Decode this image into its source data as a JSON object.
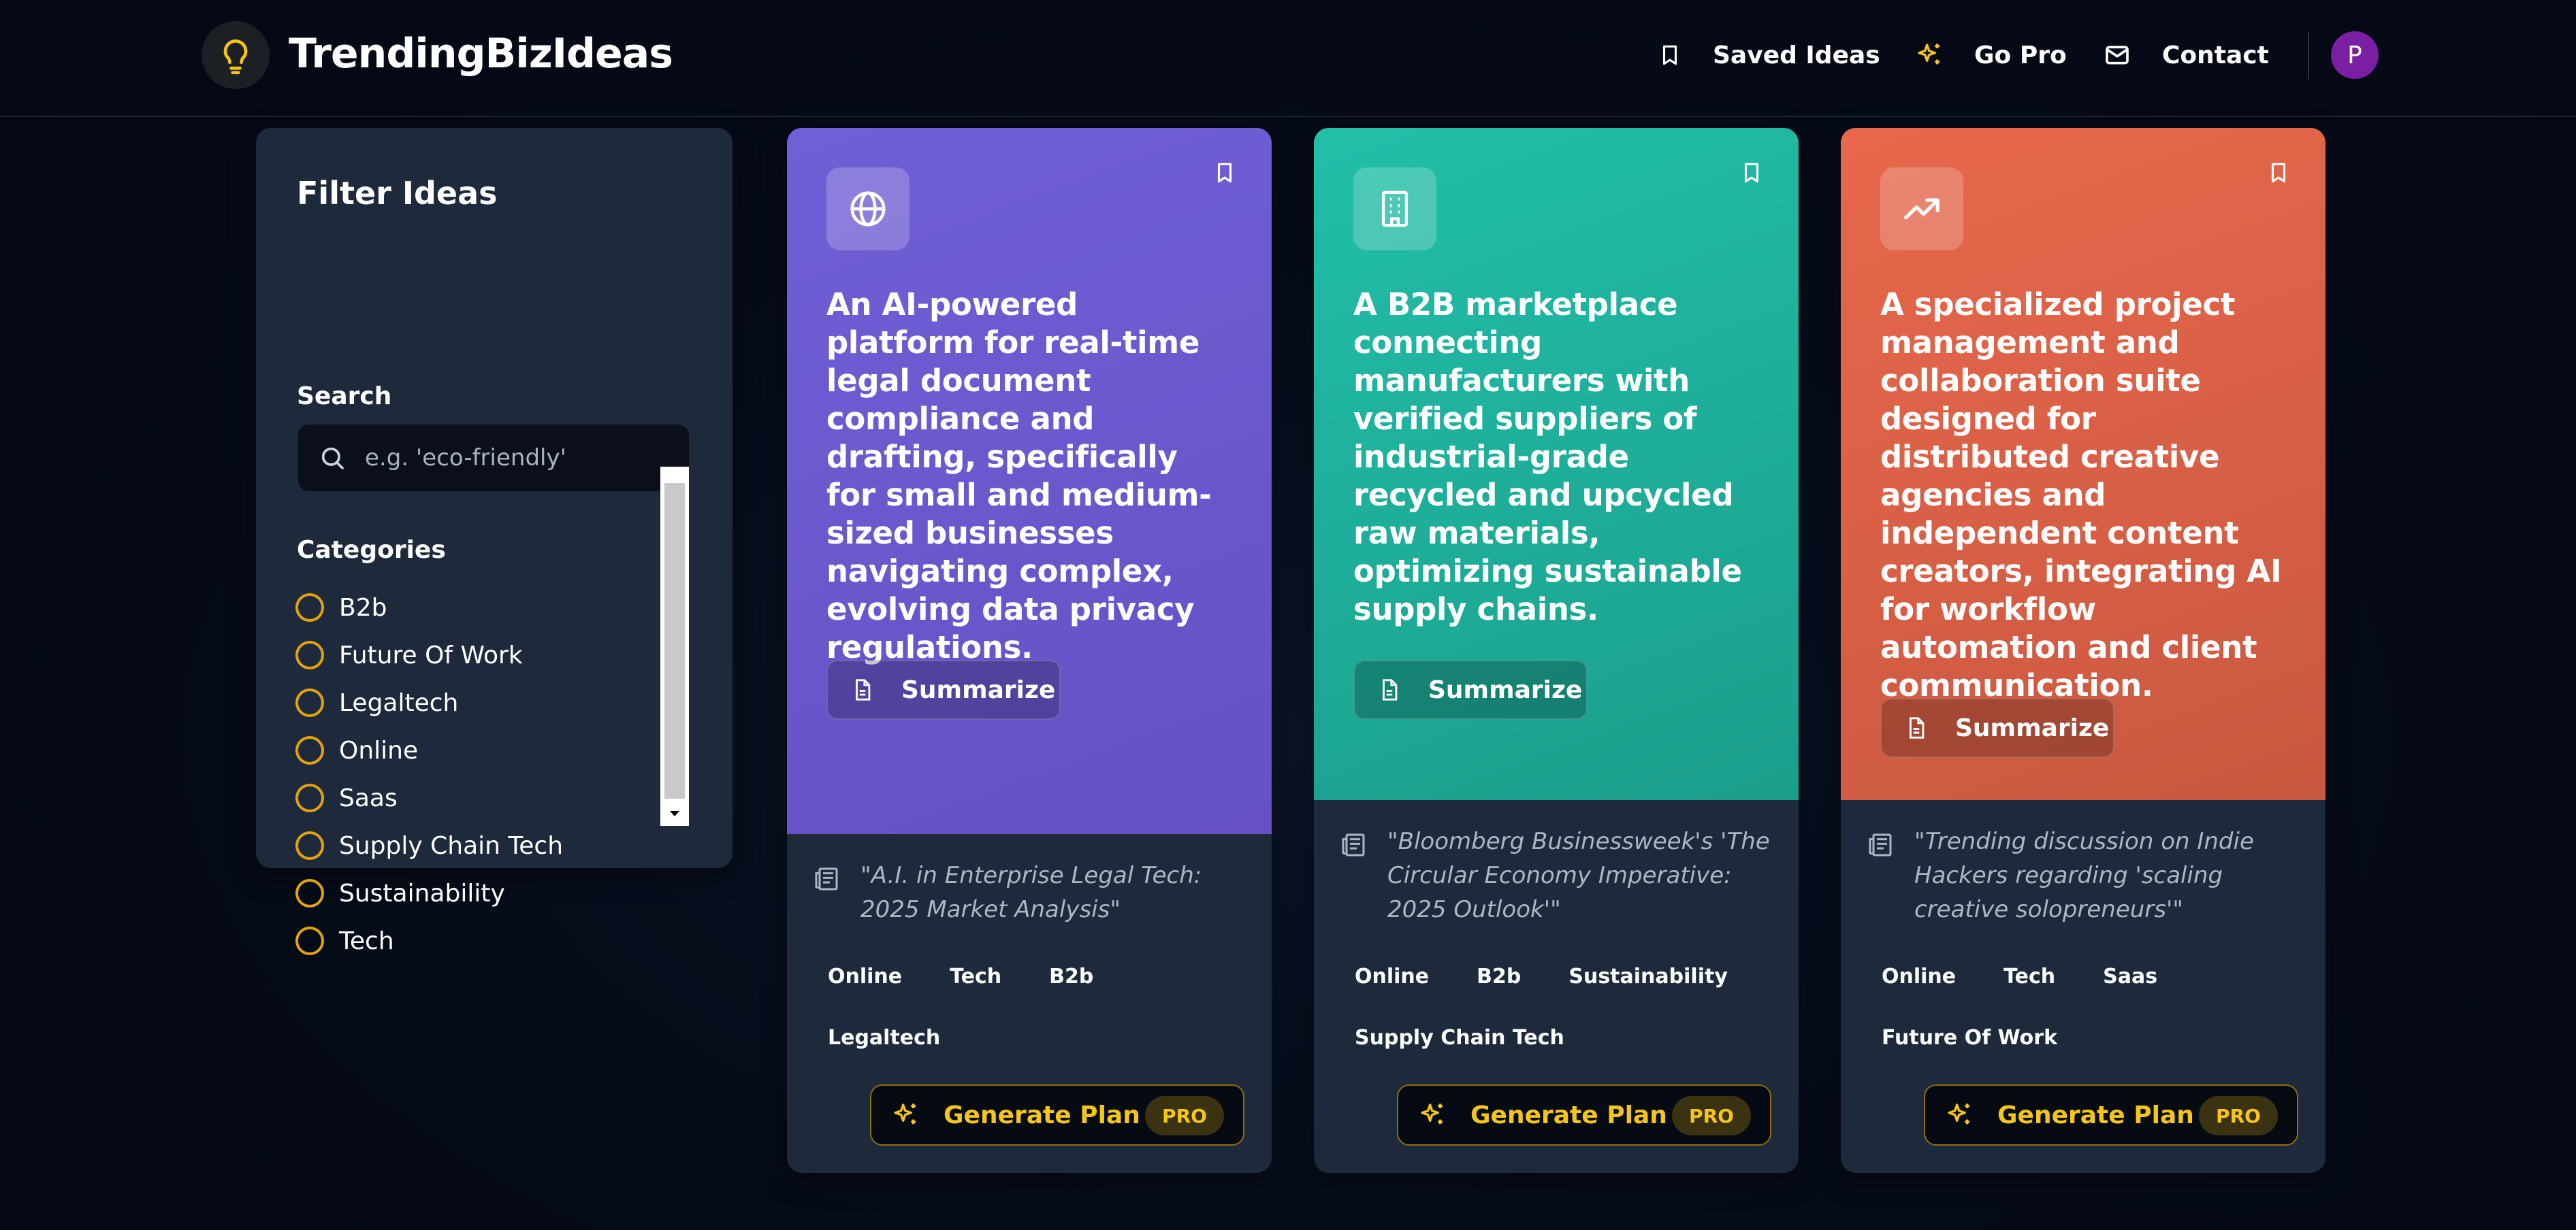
{
  "header": {
    "brand": "TrendingBizIdeas",
    "nav": [
      {
        "label": "Saved Ideas",
        "icon": "bookmark-icon"
      },
      {
        "label": "Go Pro",
        "icon": "sparkles-icon"
      },
      {
        "label": "Contact",
        "icon": "mail-icon"
      }
    ],
    "avatar_initial": "P"
  },
  "sidebar": {
    "title": "Filter Ideas",
    "search_label": "Search",
    "search_placeholder": "e.g. 'eco-friendly'",
    "categories_label": "Categories",
    "categories": [
      "B2b",
      "Future Of Work",
      "Legaltech",
      "Online",
      "Saas",
      "Supply Chain Tech",
      "Sustainability",
      "Tech"
    ]
  },
  "cards": [
    {
      "color": "#6a5bcf",
      "icon": "globe-icon",
      "title": "An AI-powered platform for real-time legal document compliance and drafting, specifically for small and medium-sized businesses navigating complex, evolving data privacy regulations.",
      "summarize_label": "Summarize",
      "source": "\"A.I. in Enterprise Legal Tech: 2025 Market Analysis\"",
      "tags": [
        "Online",
        "Tech",
        "B2b",
        "Legaltech"
      ],
      "generate_label": "Generate Plan",
      "pro_label": "PRO"
    },
    {
      "color": "#1eae9a",
      "icon": "building-icon",
      "title": "A B2B marketplace connecting manufacturers with verified suppliers of industrial-grade recycled and upcycled raw materials, optimizing sustainable supply chains.",
      "summarize_label": "Summarize",
      "source": "\"Bloomberg Businessweek's 'The Circular Economy Imperative: 2025 Outlook'\"",
      "tags": [
        "Online",
        "B2b",
        "Sustainability",
        "Supply Chain Tech"
      ],
      "generate_label": "Generate Plan",
      "pro_label": "PRO"
    },
    {
      "color": "#e2644a",
      "icon": "trending-up-icon",
      "title": "A specialized project management and collaboration suite designed for distributed creative agencies and independent content creators, integrating AI for workflow automation and client communication.",
      "summarize_label": "Summarize",
      "source": "\"Trending discussion on Indie Hackers regarding 'scaling creative solopreneurs'\"",
      "tags": [
        "Online",
        "Tech",
        "Saas",
        "Future Of Work"
      ],
      "generate_label": "Generate Plan",
      "pro_label": "PRO"
    }
  ]
}
